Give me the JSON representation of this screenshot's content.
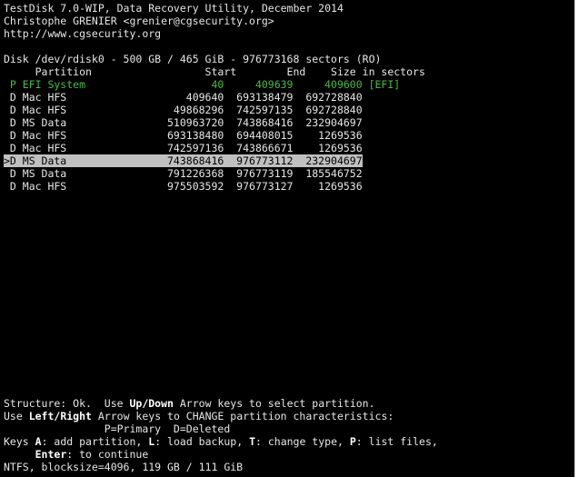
{
  "header": {
    "title": "TestDisk 7.0-WIP, Data Recovery Utility, December 2014",
    "author": "Christophe GRENIER <grenier@cgsecurity.org>",
    "url": "http://www.cgsecurity.org"
  },
  "disk": {
    "info": "Disk /dev/rdisk0 - 500 GB / 465 GiB - 976773168 sectors (RO)"
  },
  "table": {
    "header": "     Partition                  Start        End    Size in sectors",
    "rows": [
      {
        "text": " P EFI System                    40     409639     409600 [EFI]",
        "status": "primary"
      },
      {
        "text": " D Mac HFS                   409640  693138479  692728840",
        "status": "deleted"
      },
      {
        "text": " D Mac HFS                 49868296  742597135  692728840",
        "status": "deleted"
      },
      {
        "text": " D MS Data                510963720  743868416  232904697",
        "status": "deleted"
      },
      {
        "text": " D Mac HFS                693138480  694408015    1269536",
        "status": "deleted"
      },
      {
        "text": " D Mac HFS                742597136  743866671    1269536",
        "status": "deleted"
      },
      {
        "text": ">D MS Data                743868416  976773112  232904697",
        "status": "selected"
      },
      {
        "text": " D MS Data                791226368  976773119  185546752",
        "status": "deleted"
      },
      {
        "text": " D Mac HFS                975503592  976773127    1269536",
        "status": "deleted"
      }
    ]
  },
  "footer": {
    "line1_a": "Structure: Ok.  Use ",
    "line1_key": "Up/Down",
    "line1_b": " Arrow keys to select partition.",
    "line2_a": "Use ",
    "line2_key": "Left/Right",
    "line2_b": " Arrow keys to CHANGE partition characteristics:",
    "line3": "                P=Primary  D=Deleted",
    "line4_a": "Keys ",
    "line4_k1": "A",
    "line4_b": ": add partition, ",
    "line4_k2": "L",
    "line4_c": ": load backup, ",
    "line4_k3": "T",
    "line4_d": ": change type, ",
    "line4_k4": "P",
    "line4_e": ": list files,",
    "line5_a": "     ",
    "line5_key": "Enter",
    "line5_b": ": to continue",
    "line6": "NTFS, blocksize=4096, 119 GB / 111 GiB"
  },
  "colors": {
    "background": "#000000",
    "text": "#e6e6e6",
    "primary_partition": "#3ec03a",
    "selection_bg": "#c0c0c0"
  }
}
